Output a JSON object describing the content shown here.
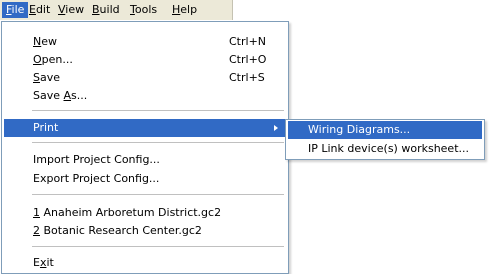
{
  "menubar": {
    "items": [
      {
        "label": "File",
        "accel": "F",
        "rest": "ile"
      },
      {
        "label": "Edit",
        "accel": "E",
        "rest": "dit"
      },
      {
        "label": "View",
        "accel": "V",
        "rest": "iew"
      },
      {
        "label": "Build",
        "accel": "B",
        "rest": "uild"
      },
      {
        "label": "Tools",
        "accel": "T",
        "rest": "ools"
      },
      {
        "label": "Help",
        "accel": "H",
        "rest": "elp"
      }
    ]
  },
  "file_menu": {
    "new": {
      "accel": "N",
      "rest": "ew",
      "shortcut": "Ctrl+N"
    },
    "open": {
      "accel": "O",
      "rest": "pen...",
      "shortcut": "Ctrl+O"
    },
    "save": {
      "accel": "S",
      "rest": "ave",
      "shortcut": "Ctrl+S"
    },
    "save_as": {
      "pre": "Save ",
      "accel": "A",
      "rest": "s..."
    },
    "print": {
      "label": "Print"
    },
    "import": {
      "label": "Import Project Config..."
    },
    "export": {
      "label": "Export Project Config..."
    },
    "recent1": {
      "accel": "1",
      "rest": " Anaheim Arboretum District.gc2"
    },
    "recent2": {
      "accel": "2",
      "rest": " Botanic Research Center.gc2"
    },
    "exit": {
      "pre": "E",
      "accel": "x",
      "rest": "it"
    }
  },
  "print_submenu": {
    "items": [
      {
        "label": "Wiring Diagrams..."
      },
      {
        "label": "IP Link device(s) worksheet..."
      }
    ]
  },
  "colors": {
    "highlight": "#316ac5",
    "menubar_bg": "#ece9d8",
    "menu_border": "#7f9db9"
  }
}
